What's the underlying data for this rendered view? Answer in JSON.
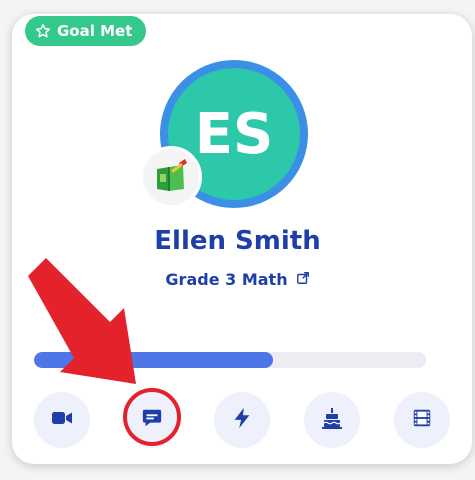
{
  "badge": {
    "label": "Goal Met",
    "icon": "star-outline-icon",
    "color": "#34c98a"
  },
  "student": {
    "initials": "ES",
    "name": "Ellen Smith",
    "grade": "Grade 3 Math",
    "subject_icon": "math-book-icon",
    "avatar_color": "#2dc7a9",
    "ring_color": "#3b8fe6"
  },
  "progress": {
    "fraction": 0.61,
    "fill_color": "#4f76e6"
  },
  "actions": [
    {
      "icon": "video-camera-icon"
    },
    {
      "icon": "chat-bubble-icon"
    },
    {
      "icon": "lightning-bolt-icon"
    },
    {
      "icon": "birthday-cake-icon"
    },
    {
      "icon": "film-strip-icon"
    }
  ],
  "annotation": {
    "arrow_color": "#e3222b",
    "highlighted_action": "chat-bubble-icon"
  }
}
